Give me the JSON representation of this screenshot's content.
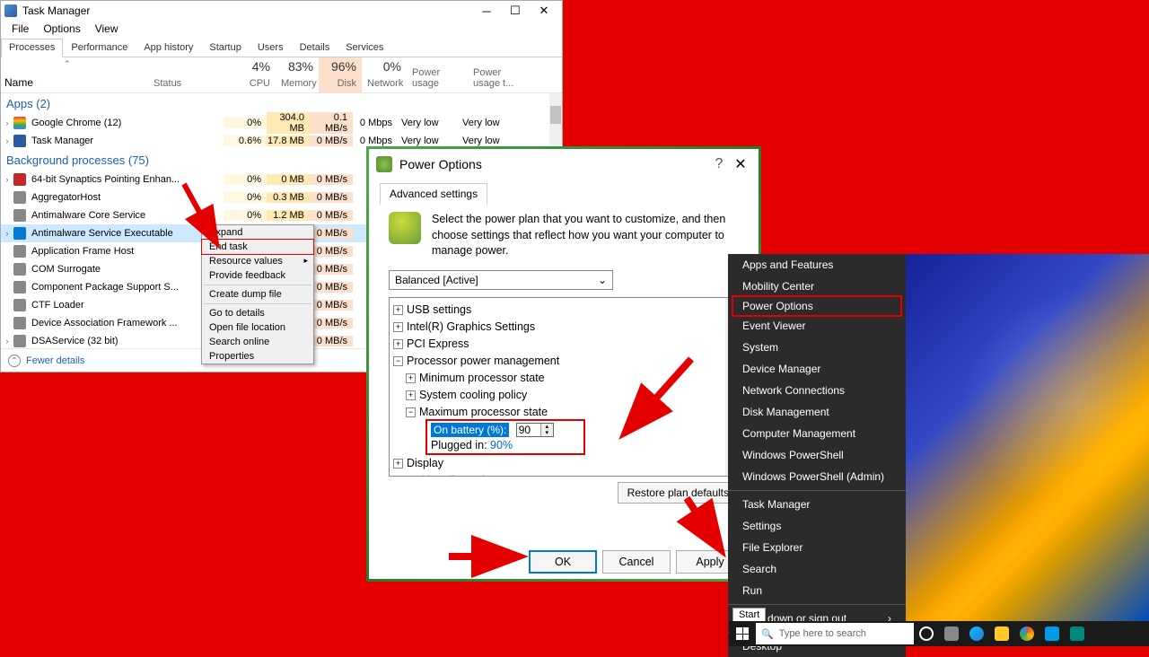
{
  "taskManager": {
    "title": "Task Manager",
    "menu": [
      "File",
      "Options",
      "View"
    ],
    "tabs": [
      "Processes",
      "Performance",
      "App history",
      "Startup",
      "Users",
      "Details",
      "Services"
    ],
    "columns": {
      "name": "Name",
      "status": "Status",
      "cpu": {
        "pct": "4%",
        "label": "CPU"
      },
      "memory": {
        "pct": "83%",
        "label": "Memory"
      },
      "disk": {
        "pct": "96%",
        "label": "Disk"
      },
      "network": {
        "pct": "0%",
        "label": "Network"
      },
      "power": "Power usage",
      "powerTrend": "Power usage t..."
    },
    "sections": {
      "apps": "Apps (2)",
      "bg": "Background processes (75)"
    },
    "rows": {
      "chrome": {
        "name": "Google Chrome (12)",
        "cpu": "0%",
        "mem": "304.0 MB",
        "disk": "0.1 MB/s",
        "net": "0 Mbps",
        "pw": "Very low",
        "pw2": "Very low"
      },
      "tm": {
        "name": "Task Manager",
        "cpu": "0.6%",
        "mem": "17.8 MB",
        "disk": "0 MB/s",
        "net": "0 Mbps",
        "pw": "Very low",
        "pw2": "Very low"
      },
      "syn": {
        "name": "64-bit Synaptics Pointing Enhan...",
        "cpu": "0%",
        "mem": "0 MB",
        "disk": "0 MB/s"
      },
      "agg": {
        "name": "AggregatorHost",
        "cpu": "0%",
        "mem": "0.3 MB",
        "disk": "0 MB/s"
      },
      "amc": {
        "name": "Antimalware Core Service",
        "cpu": "0%",
        "mem": "1.2 MB",
        "disk": "0 MB/s"
      },
      "ams": {
        "name": "Antimalware Service Executable",
        "disk": "0 MB/s"
      },
      "afh": {
        "name": "Application Frame Host",
        "disk": "0 MB/s"
      },
      "com": {
        "name": "COM Surrogate",
        "disk": "0 MB/s"
      },
      "cps": {
        "name": "Component Package Support S...",
        "disk": "0 MB/s"
      },
      "ctf": {
        "name": "CTF Loader",
        "disk": "0 MB/s"
      },
      "daf": {
        "name": "Device Association Framework ...",
        "disk": "0 MB/s"
      },
      "dsa": {
        "name": "DSAService (32 bit)",
        "disk": "0 MB/s"
      }
    },
    "fewer": "Fewer details",
    "context": {
      "expand": "Expand",
      "endTask": "End task",
      "resourceValues": "Resource values",
      "provideFeedback": "Provide feedback",
      "createDump": "Create dump file",
      "goToDetails": "Go to details",
      "openLocation": "Open file location",
      "searchOnline": "Search online",
      "properties": "Properties"
    }
  },
  "powerOptions": {
    "title": "Power Options",
    "tab": "Advanced settings",
    "desc": "Select the power plan that you want to customize, and then choose settings that reflect how you want your computer to manage power.",
    "plan": "Balanced [Active]",
    "tree": {
      "usb": "USB settings",
      "intel": "Intel(R) Graphics Settings",
      "pci": "PCI Express",
      "ppm": "Processor power management",
      "min": "Minimum processor state",
      "cool": "System cooling policy",
      "max": "Maximum processor state",
      "onBattLabel": "On battery (%):",
      "onBattVal": "90",
      "plugged": "Plugged in:",
      "pluggedVal": "90%",
      "display": "Display",
      "multi": "Multimedia settings"
    },
    "restore": "Restore plan defaults",
    "ok": "OK",
    "cancel": "Cancel",
    "apply": "Apply"
  },
  "winx": {
    "apps": "Apps and Features",
    "mobility": "Mobility Center",
    "power": "Power Options",
    "event": "Event Viewer",
    "system": "System",
    "device": "Device Manager",
    "netconn": "Network Connections",
    "diskmgmt": "Disk Management",
    "compmgmt": "Computer Management",
    "ps": "Windows PowerShell",
    "psa": "Windows PowerShell (Admin)",
    "tm": "Task Manager",
    "settings": "Settings",
    "explorer": "File Explorer",
    "search": "Search",
    "run": "Run",
    "shutdown": "Shut down or sign out",
    "desktop": "Desktop"
  },
  "startTip": "Start",
  "taskbar": {
    "search": "Type here to search"
  }
}
